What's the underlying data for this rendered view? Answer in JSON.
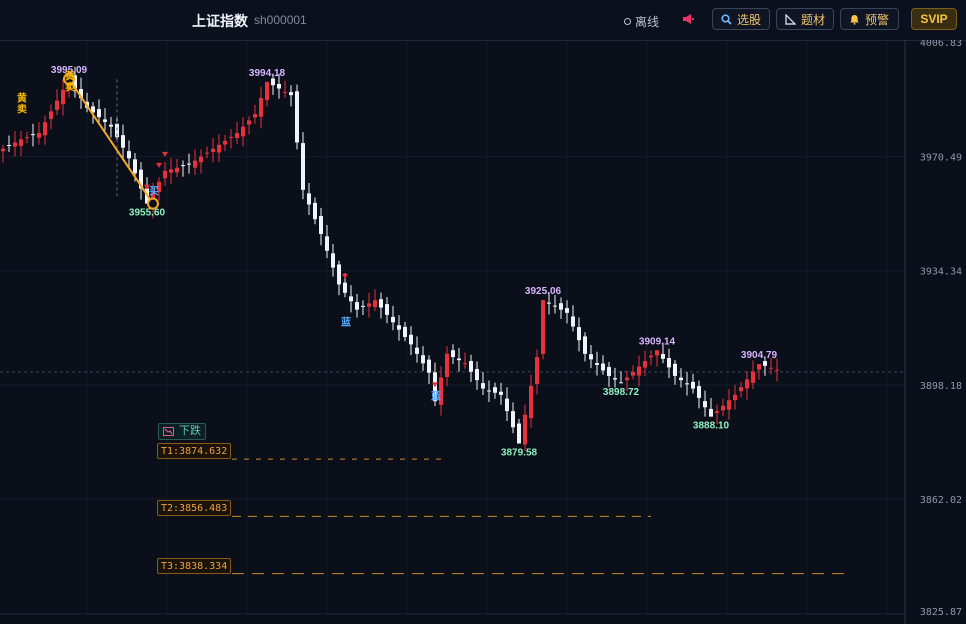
{
  "header": {
    "title": "上证指数",
    "code": "sh000001",
    "status": "离线",
    "buttons": [
      {
        "label": "选股",
        "icon": "search-icon"
      },
      {
        "label": "题材",
        "icon": "ruler-icon"
      },
      {
        "label": "预警",
        "icon": "bell-icon"
      }
    ],
    "vip_label": "SVIP"
  },
  "chart_data": {
    "type": "candlestick",
    "ylim": [
      3825.87,
      4006.83
    ],
    "y_ticks": [
      "4006.83",
      "3970.49",
      "3934.34",
      "3898.18",
      "3862.02",
      "3825.87"
    ],
    "reference_price": 3902.3,
    "bar_count": 130,
    "up_color": "#e8313a",
    "down_color": "#f0f3f8",
    "annotations": [
      {
        "index": 11,
        "value": 3995.09,
        "label": "3995.09",
        "kind": "high"
      },
      {
        "index": 24,
        "value": 3955.6,
        "label": "3955.60",
        "kind": "low"
      },
      {
        "index": 44,
        "value": 3994.18,
        "label": "3994.18",
        "kind": "high"
      },
      {
        "index": 86,
        "value": 3879.58,
        "label": "3879.58",
        "kind": "low"
      },
      {
        "index": 90,
        "value": 3925.06,
        "label": "3925.06",
        "kind": "high"
      },
      {
        "index": 103,
        "value": 3898.72,
        "label": "3898.72",
        "kind": "low"
      },
      {
        "index": 109,
        "value": 3909.14,
        "label": "3909.14",
        "kind": "high"
      },
      {
        "index": 118,
        "value": 3888.1,
        "label": "3888.10",
        "kind": "low"
      },
      {
        "index": 126,
        "value": 3904.79,
        "label": "3904.79",
        "kind": "high"
      }
    ],
    "signals": [
      {
        "index": 3,
        "text": "黄",
        "color": "#f5b700",
        "value": 3988.0
      },
      {
        "index": 3,
        "text": "卖",
        "color": "#f5b700",
        "value": 3984.5
      },
      {
        "index": 11,
        "text": "黄",
        "color": "#f5b700",
        "value": 3995.0
      },
      {
        "index": 11,
        "text": "卖",
        "color": "#f5b700",
        "value": 3991.5
      },
      {
        "index": 25,
        "text": "买",
        "color": "#5aaaff",
        "value": 3958.5
      },
      {
        "index": 57,
        "text": "蓝",
        "color": "#5aaaff",
        "value": 3917.0
      },
      {
        "index": 72,
        "text": "蓝",
        "color": "#5aaaff",
        "value": 3893.5
      }
    ],
    "markers": [
      24,
      26,
      27,
      57,
      72
    ],
    "trend_line": {
      "from": {
        "index": 11,
        "value": 3995.09
      },
      "to": {
        "index": 25,
        "value": 3955.6
      }
    },
    "prediction_label": "下跌",
    "targets": [
      {
        "label": "T1:3874.632",
        "value": 3874.632,
        "end_index": 74
      },
      {
        "label": "T2:3856.483",
        "value": 3856.483,
        "end_index": 108
      },
      {
        "label": "T3:3838.334",
        "value": 3838.334,
        "end_index": 141
      }
    ]
  }
}
